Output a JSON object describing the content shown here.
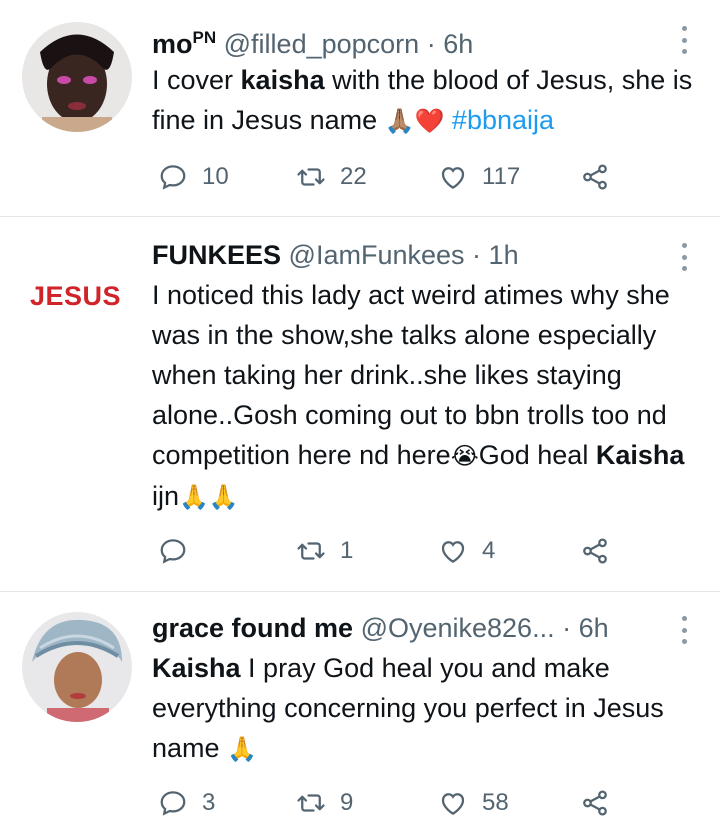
{
  "tweets": [
    {
      "name": "mo",
      "name_sup": "PN",
      "handle": "@filled_popcorn",
      "dot": "·",
      "time": "6h",
      "body_pre": "I cover ",
      "body_bold": "kaisha",
      "body_post": " with the blood of Jesus, she is fine in Jesus name",
      "emoji": "🙏🏽❤️",
      "hashtag": "#bbnaija",
      "replies": "10",
      "retweets": "22",
      "likes": "117"
    },
    {
      "name": "FUNKEES",
      "handle": "@IamFunkees",
      "dot": "·",
      "time": "1h",
      "avatar_text": "JESUS",
      "body_pre": "I noticed this lady act weird atimes why she was in the show,she talks alone especially when taking her drink..she likes staying alone..Gosh coming out to bbn trolls too nd competition here nd here",
      "emoji_mid": "😭",
      "body_mid": "God heal ",
      "body_bold": "Kaisha",
      "body_post": " ijn",
      "emoji": "🙏🙏",
      "replies": "",
      "retweets": "1",
      "likes": "4"
    },
    {
      "name": "grace found me",
      "handle": "@Oyenike826...",
      "dot": "·",
      "time": "6h",
      "body_bold": "Kaisha",
      "body_post": " I pray God heal you and make everything concerning you perfect in Jesus name",
      "emoji": "🙏",
      "replies": "3",
      "retweets": "9",
      "likes": "58"
    }
  ],
  "icons": {
    "reply": "reply-icon",
    "retweet": "retweet-icon",
    "like": "heart-icon",
    "share": "share-icon",
    "more": "more-icon"
  },
  "colors": {
    "text": "#0f1419",
    "secondary": "#536471",
    "link": "#1d9bf0",
    "logo_red": "#d0232a",
    "divider": "#e1e6ea"
  }
}
